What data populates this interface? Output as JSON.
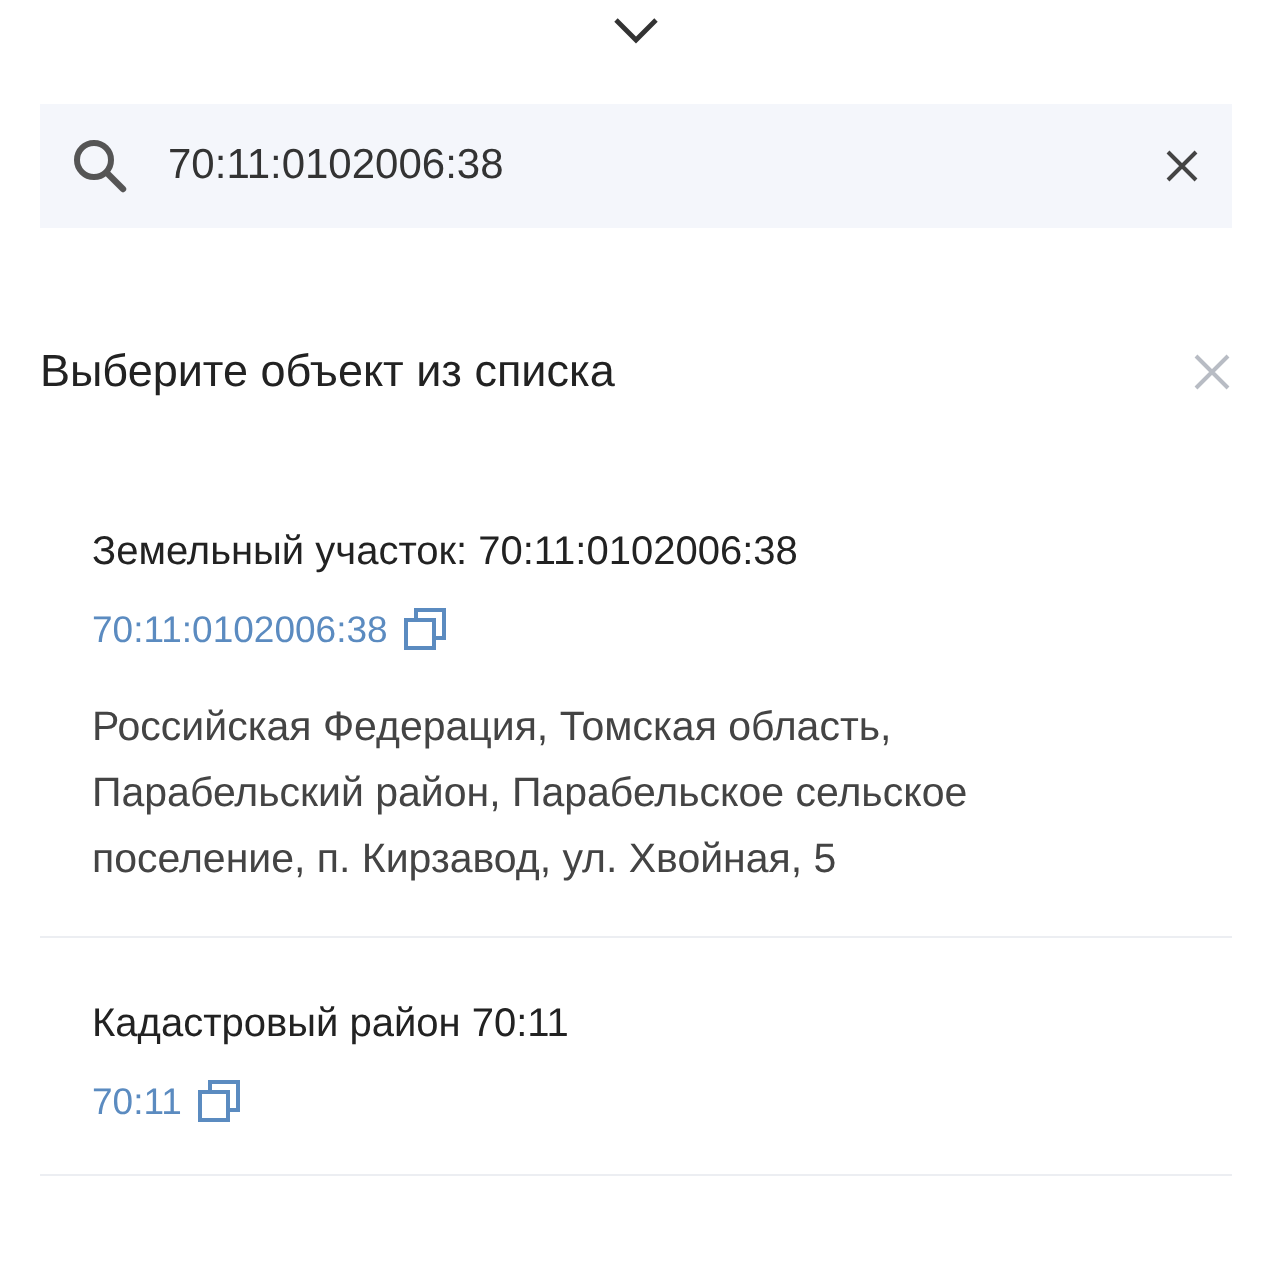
{
  "search": {
    "value": "70:11:0102006:38"
  },
  "heading": "Выберите объект из списка",
  "results": [
    {
      "title": "Земельный участок: 70:11:0102006:38",
      "number": "70:11:0102006:38",
      "address": "Российская Федерация, Томская область, Парабельский район, Парабельское сельское поселение, п. Кирзавод, ул. Хвойная, 5"
    },
    {
      "title": "Кадастровый район 70:11",
      "number": "70:11"
    }
  ]
}
